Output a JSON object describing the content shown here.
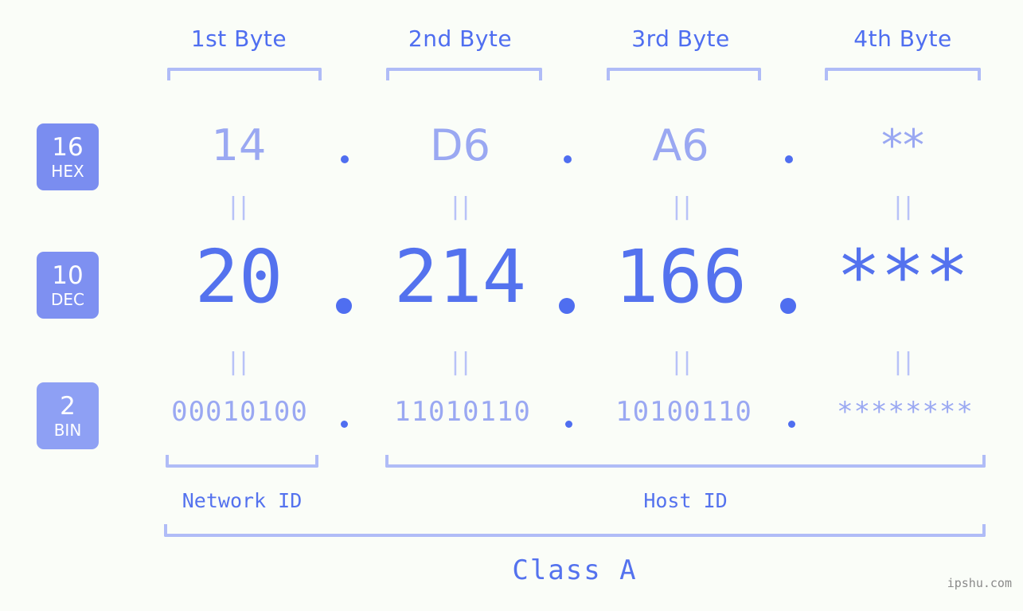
{
  "page": {
    "background_color": "#fafdf8",
    "accent_color": "#4f6ef0",
    "muted_accent_color": "#a8b4f5",
    "bracket_color": "#b0bcf7"
  },
  "byte_headers": [
    {
      "label": "1st Byte"
    },
    {
      "label": "2nd Byte"
    },
    {
      "label": "3rd Byte"
    },
    {
      "label": "4th Byte"
    }
  ],
  "radix_badges": [
    {
      "number": "16",
      "name": "HEX",
      "color": "#7a8df0"
    },
    {
      "number": "10",
      "name": "DEC",
      "color": "#7e90f1"
    },
    {
      "number": "2",
      "name": "BIN",
      "color": "#8ea0f4"
    }
  ],
  "rows": {
    "hex": {
      "radix": "16",
      "radix_name": "HEX",
      "values": [
        "14",
        "D6",
        "A6",
        "**"
      ]
    },
    "dec": {
      "radix": "10",
      "radix_name": "DEC",
      "values": [
        "20",
        "214",
        "166",
        "***"
      ]
    },
    "bin": {
      "radix": "2",
      "radix_name": "BIN",
      "values": [
        "00010100",
        "11010110",
        "10100110",
        "********"
      ]
    }
  },
  "separators": {
    "dot": ".",
    "equality_mark": "||"
  },
  "sections": [
    {
      "label": "Network ID"
    },
    {
      "label": "Host ID"
    }
  ],
  "class_label": "Class A",
  "watermark": "ipshu.com"
}
